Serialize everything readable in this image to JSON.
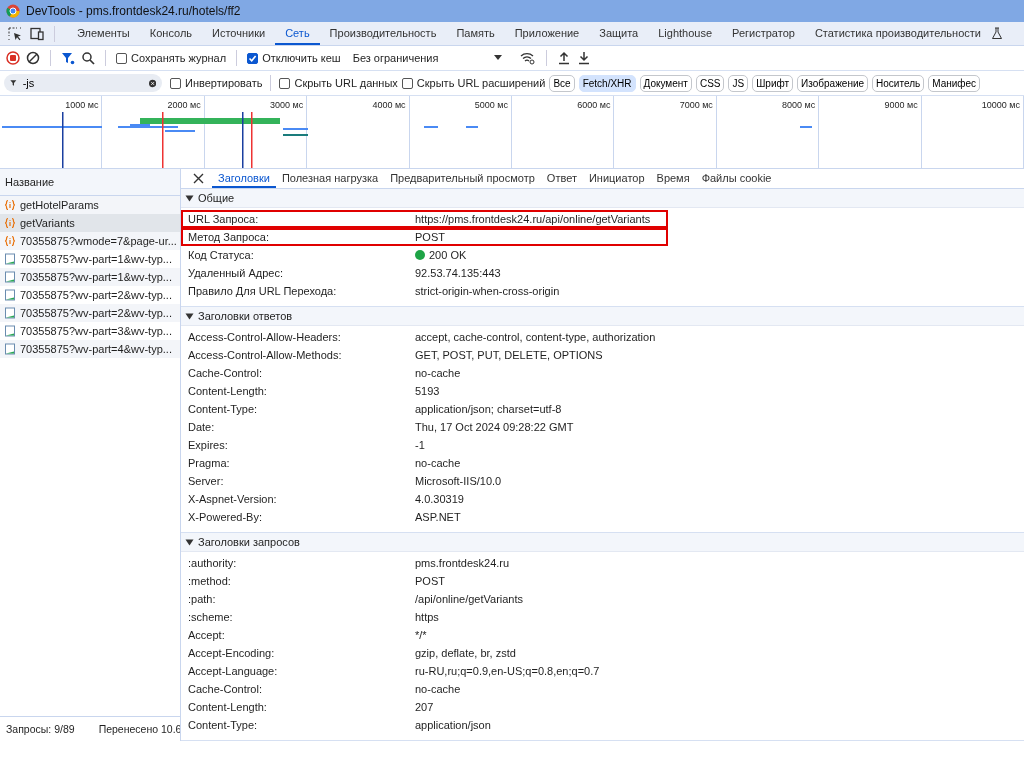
{
  "window": {
    "title": "DevTools - pms.frontdesk24.ru/hotels/ff2"
  },
  "main_tabs": [
    {
      "label": "Элементы",
      "selected": false
    },
    {
      "label": "Консоль",
      "selected": false
    },
    {
      "label": "Источники",
      "selected": false
    },
    {
      "label": "Сеть",
      "selected": true
    },
    {
      "label": "Производительность",
      "selected": false
    },
    {
      "label": "Память",
      "selected": false
    },
    {
      "label": "Приложение",
      "selected": false
    },
    {
      "label": "Защита",
      "selected": false
    },
    {
      "label": "Lighthouse",
      "selected": false
    },
    {
      "label": "Регистратор",
      "selected": false
    },
    {
      "label": "Статистика производительности",
      "selected": false
    }
  ],
  "toolbar": {
    "preserve_log": {
      "label": "Сохранять журнал",
      "checked": false
    },
    "disable_cache": {
      "label": "Отключить кеш",
      "checked": true
    },
    "throttling": "Без ограничения"
  },
  "filter": {
    "value": "-js",
    "invert": {
      "label": "Инвертировать",
      "checked": false
    },
    "hide_data_urls": {
      "label": "Скрыть URL данных",
      "checked": false
    },
    "hide_extension_urls": {
      "label": "Скрыть URL расширений",
      "checked": false
    },
    "types": [
      {
        "label": "Все",
        "selected": false
      },
      {
        "label": "Fetch/XHR",
        "selected": true
      },
      {
        "label": "Документ",
        "selected": false
      },
      {
        "label": "CSS",
        "selected": false
      },
      {
        "label": "JS",
        "selected": false
      },
      {
        "label": "Шрифт",
        "selected": false
      },
      {
        "label": "Изображение",
        "selected": false
      },
      {
        "label": "Носитель",
        "selected": false
      },
      {
        "label": "Манифес",
        "selected": false
      }
    ]
  },
  "timeline": {
    "ticks": [
      "1000 мс",
      "2000 мс",
      "3000 мс",
      "4000 мс",
      "5000 мс",
      "6000 мс",
      "7000 мс",
      "8000 мс",
      "9000 мс",
      "10000 мс"
    ]
  },
  "requests": {
    "header": "Название",
    "rows": [
      {
        "name": "getHotelParams",
        "kind": "fetch",
        "selected": false
      },
      {
        "name": "getVariants",
        "kind": "fetch",
        "selected": true
      },
      {
        "name": "70355875?wmode=7&page-ur...",
        "kind": "fetch",
        "selected": false
      },
      {
        "name": "70355875?wv-part=1&wv-typ...",
        "kind": "image",
        "selected": false
      },
      {
        "name": "70355875?wv-part=1&wv-typ...",
        "kind": "image",
        "selected": false
      },
      {
        "name": "70355875?wv-part=2&wv-typ...",
        "kind": "image",
        "selected": false
      },
      {
        "name": "70355875?wv-part=2&wv-typ...",
        "kind": "image",
        "selected": false
      },
      {
        "name": "70355875?wv-part=3&wv-typ...",
        "kind": "image",
        "selected": false
      },
      {
        "name": "70355875?wv-part=4&wv-typ...",
        "kind": "image",
        "selected": false
      }
    ]
  },
  "details": {
    "tabs": [
      {
        "label": "Заголовки",
        "selected": true
      },
      {
        "label": "Полезная нагрузка",
        "selected": false
      },
      {
        "label": "Предварительный просмотр",
        "selected": false
      },
      {
        "label": "Ответ",
        "selected": false
      },
      {
        "label": "Инициатор",
        "selected": false
      },
      {
        "label": "Время",
        "selected": false
      },
      {
        "label": "Файлы cookie",
        "selected": false
      }
    ],
    "sections": [
      {
        "title": "Общие",
        "expanded": true,
        "rows": [
          {
            "name": "URL Запроса:",
            "value": "https://pms.frontdesk24.ru/api/online/getVariants",
            "highlighted": true
          },
          {
            "name": "Метод Запроса:",
            "value": "POST",
            "highlighted": true
          },
          {
            "name": "Код Статуса:",
            "value": "200 OK",
            "highlighted": false,
            "color": "#1ea446"
          },
          {
            "name": "Удаленный Адрес:",
            "value": "92.53.74.135:443",
            "highlighted": false
          },
          {
            "name": "Правило Для URL Перехода:",
            "value": "strict-origin-when-cross-origin",
            "highlighted": false
          }
        ]
      },
      {
        "title": "Заголовки ответов",
        "expanded": true,
        "rows": [
          {
            "name": "Access-Control-Allow-Headers:",
            "value": "accept, cache-control, content-type, authorization",
            "highlighted": false
          },
          {
            "name": "Access-Control-Allow-Methods:",
            "value": "GET, POST, PUT, DELETE, OPTIONS",
            "highlighted": false
          },
          {
            "name": "Cache-Control:",
            "value": "no-cache",
            "highlighted": false
          },
          {
            "name": "Content-Length:",
            "value": "5193",
            "highlighted": false
          },
          {
            "name": "Content-Type:",
            "value": "application/json; charset=utf-8",
            "highlighted": false
          },
          {
            "name": "Date:",
            "value": "Thu, 17 Oct 2024 09:28:22 GMT",
            "highlighted": false
          },
          {
            "name": "Expires:",
            "value": "-1",
            "highlighted": false
          },
          {
            "name": "Pragma:",
            "value": "no-cache",
            "highlighted": false
          },
          {
            "name": "Server:",
            "value": "Microsoft-IIS/10.0",
            "highlighted": false
          },
          {
            "name": "X-Aspnet-Version:",
            "value": "4.0.30319",
            "highlighted": false
          },
          {
            "name": "X-Powered-By:",
            "value": "ASP.NET",
            "highlighted": false
          }
        ]
      },
      {
        "title": "Заголовки запросов",
        "expanded": true,
        "rows": [
          {
            "name": ":authority:",
            "value": "pms.frontdesk24.ru",
            "highlighted": false
          },
          {
            "name": ":method:",
            "value": "POST",
            "highlighted": false
          },
          {
            "name": ":path:",
            "value": "/api/online/getVariants",
            "highlighted": false
          },
          {
            "name": ":scheme:",
            "value": "https",
            "highlighted": false
          },
          {
            "name": "Accept:",
            "value": "*/*",
            "highlighted": false
          },
          {
            "name": "Accept-Encoding:",
            "value": "gzip, deflate, br, zstd",
            "highlighted": false
          },
          {
            "name": "Accept-Language:",
            "value": "ru-RU,ru;q=0.9,en-US;q=0.8,en;q=0.7",
            "highlighted": false
          },
          {
            "name": "Cache-Control:",
            "value": "no-cache",
            "highlighted": false
          },
          {
            "name": "Content-Length:",
            "value": "207",
            "highlighted": false
          },
          {
            "name": "Content-Type:",
            "value": "application/json",
            "highlighted": false
          }
        ]
      }
    ]
  },
  "status_bar": [
    "Запросы: 9/89",
    "Перенесено 10.6"
  ]
}
